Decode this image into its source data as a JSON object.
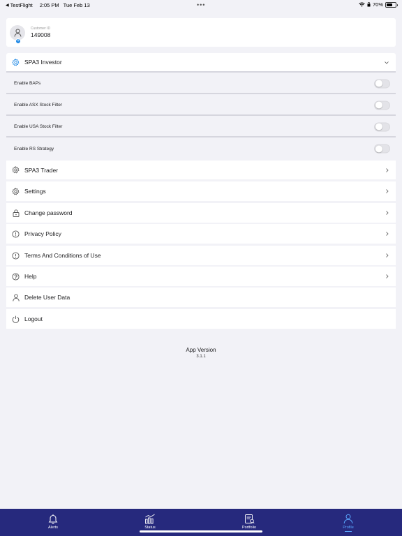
{
  "status_bar": {
    "back_app": "TestFlight",
    "time": "2:05 PM",
    "date": "Tue Feb 13",
    "battery_percent": "70%",
    "battery_level": 0.7
  },
  "profile": {
    "customer_id_label": "Customer ID",
    "customer_id": "149008"
  },
  "investor_section": {
    "title": "SPA3 Investor",
    "expanded": true,
    "toggles": [
      {
        "label": "Enable BAPs",
        "on": false
      },
      {
        "label": "Enable ASX Stock Filter",
        "on": false
      },
      {
        "label": "Enable USA Stock Filter",
        "on": false
      },
      {
        "label": "Enable RS Strategy",
        "on": false
      }
    ]
  },
  "menu": {
    "trader": "SPA3 Trader",
    "settings": "Settings",
    "change_password": "Change password",
    "privacy": "Privacy Policy",
    "terms": "Terms And Conditions of Use",
    "help": "Help",
    "delete": "Delete User Data",
    "logout": "Logout"
  },
  "app_version": {
    "label": "App Version",
    "number": "3.1.1"
  },
  "tabs": [
    {
      "label": "Alerts",
      "icon": "bell-icon",
      "active": false
    },
    {
      "label": "Status",
      "icon": "chart-icon",
      "active": false
    },
    {
      "label": "Portfolio",
      "icon": "portfolio-icon",
      "active": false
    },
    {
      "label": "Profile",
      "icon": "profile-icon",
      "active": true
    }
  ],
  "colors": {
    "accent": "#1e88e5",
    "tab_bar": "#26297d",
    "tab_active": "#5aa8ff",
    "background": "#f2f2f7"
  }
}
